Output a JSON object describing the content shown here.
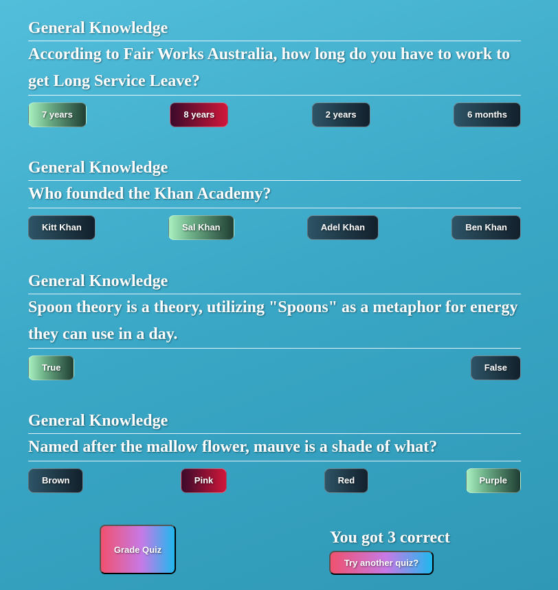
{
  "questions": [
    {
      "category": "General Knowledge",
      "question": "According to Fair Works Australia, how long do you have to work to get Long Service Leave?",
      "answers": [
        {
          "label": "7 years",
          "state": "correct"
        },
        {
          "label": "8 years",
          "state": "wrong"
        },
        {
          "label": "2 years",
          "state": "neutral"
        },
        {
          "label": "6 months",
          "state": "neutral"
        }
      ]
    },
    {
      "category": "General Knowledge",
      "question": "Who founded the Khan Academy?",
      "answers": [
        {
          "label": "Kitt Khan",
          "state": "neutral"
        },
        {
          "label": "Sal Khan",
          "state": "correct"
        },
        {
          "label": "Adel Khan",
          "state": "neutral"
        },
        {
          "label": "Ben Khan",
          "state": "neutral"
        }
      ]
    },
    {
      "category": "General Knowledge",
      "question": "Spoon theory is a theory, utilizing \"Spoons\" as a metaphor for energy they can use in a day.",
      "answers": [
        {
          "label": "True",
          "state": "correct"
        },
        {
          "label": "False",
          "state": "neutral"
        }
      ]
    },
    {
      "category": "General Knowledge",
      "question": "Named after the mallow flower, mauve is a shade of what?",
      "answers": [
        {
          "label": "Brown",
          "state": "neutral"
        },
        {
          "label": "Pink",
          "state": "wrong"
        },
        {
          "label": "Red",
          "state": "neutral"
        },
        {
          "label": "Purple",
          "state": "correct"
        }
      ]
    }
  ],
  "footer": {
    "grade_label": "Grade Quiz",
    "result_text": "You got 3 correct",
    "retry_label": "Try another quiz?"
  },
  "colors": {
    "background": "#3aa7c6",
    "correct": "#a8f0bf",
    "wrong": "#d0173a",
    "neutral": "#12202b"
  }
}
